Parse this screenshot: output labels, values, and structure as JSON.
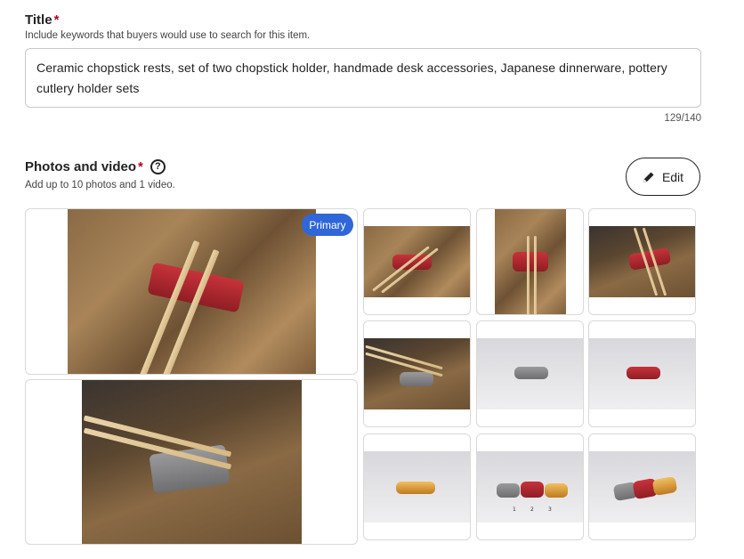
{
  "title_section": {
    "label": "Title",
    "required_mark": "*",
    "help": "Include keywords that buyers would use to search for this item.",
    "value": "Ceramic chopstick rests, set of two chopstick holder, handmade desk accessories, Japanese dinnerware, pottery cutlery holder sets",
    "counter": "129/140"
  },
  "photos_section": {
    "label": "Photos and video",
    "required_mark": "*",
    "help_icon": "question-circle-icon",
    "help": "Add up to 10 photos and 1 video.",
    "edit_label": "Edit",
    "edit_icon": "pencil-icon",
    "primary_badge": "Primary",
    "badge_color": "#2f67d8",
    "photo_count": 11,
    "numbers_caption": [
      "1",
      "2",
      "3"
    ]
  }
}
